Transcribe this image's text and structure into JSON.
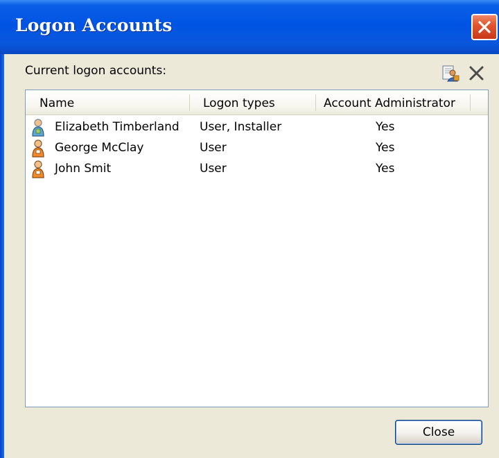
{
  "window": {
    "title": "Logon Accounts"
  },
  "section": {
    "label": "Current logon accounts:"
  },
  "toolbar": {
    "add_icon": "add-user-icon",
    "remove_icon": "delete-x-icon"
  },
  "table": {
    "columns": [
      "Name",
      "Logon types",
      "Account Administrator"
    ],
    "rows": [
      {
        "name": "Elizabeth Timberland",
        "logon_types": "User, Installer",
        "admin": "Yes",
        "icon": "user-installer-icon"
      },
      {
        "name": "George McClay",
        "logon_types": "User",
        "admin": "Yes",
        "icon": "user-icon"
      },
      {
        "name": "John Smit",
        "logon_types": "User",
        "admin": "Yes",
        "icon": "user-icon"
      }
    ]
  },
  "buttons": {
    "close_label": "Close"
  },
  "colors": {
    "titlebar": "#0054E3",
    "close_button": "#E2562E",
    "window_bg": "#ECE9D8",
    "list_border": "#7F9DB9"
  }
}
